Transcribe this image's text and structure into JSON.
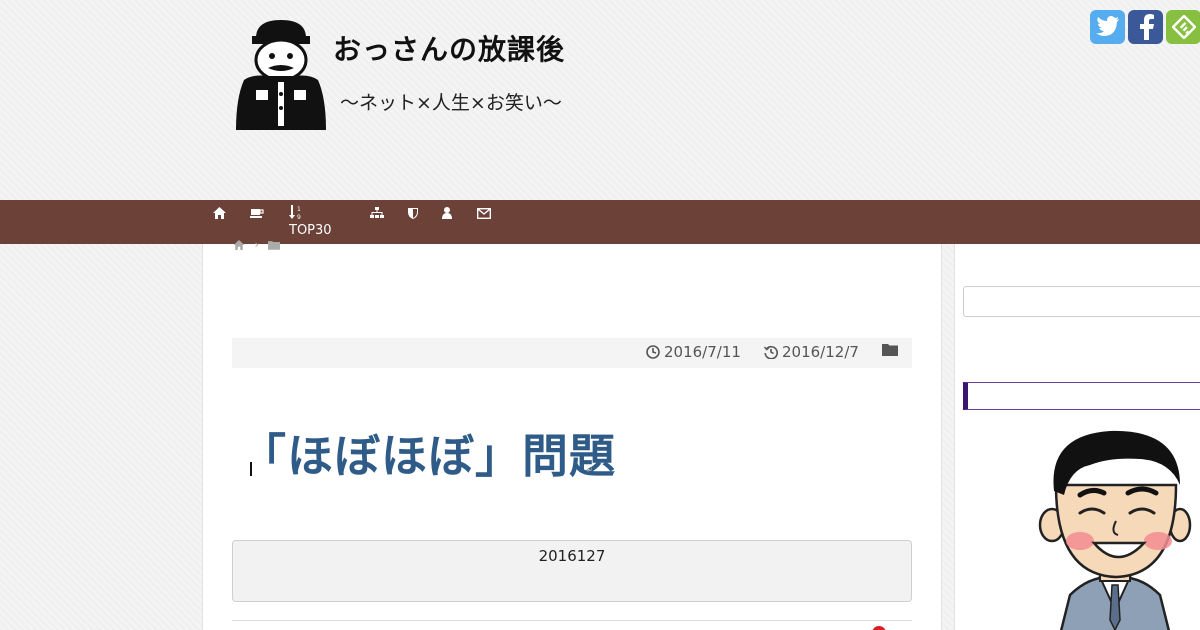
{
  "header": {
    "site_title": "おっさんの放課後",
    "tagline": "〜ネット×人生×お笑い〜"
  },
  "social": {
    "twitter_glyph": "t",
    "facebook_glyph": "f",
    "feedly_glyph": "f"
  },
  "nav": {
    "top30_label": "TOP30",
    "icons": [
      "home-icon",
      "coffee-icon",
      "sort-numeric-icon",
      "sitemap-icon",
      "shield-icon",
      "user-icon",
      "envelope-icon"
    ]
  },
  "post": {
    "published": "2016/7/11",
    "updated": "2016/12/7",
    "title": "「ほぼほぼ」問題",
    "update_note": "2016127"
  },
  "colors": {
    "nav_bg": "#6b4138",
    "title_color": "#2f5b88",
    "twitter": "#55acee",
    "facebook": "#3b5998",
    "feedly": "#87c040",
    "widget_accent": "#3a1670"
  }
}
